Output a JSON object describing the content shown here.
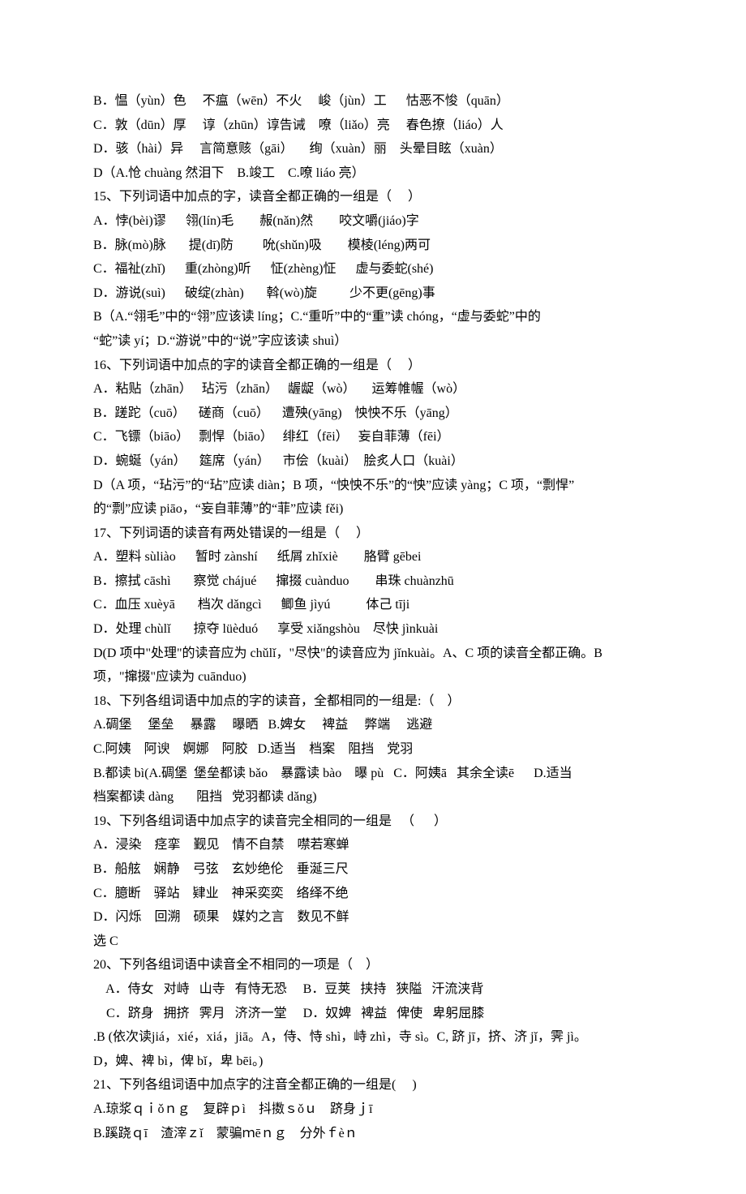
{
  "lines": [
    "B．愠（yùn）色     不瘟（wēn）不火     峻（jùn）工      怙恶不悛（quān）",
    "C．敦（dūn）厚     谆（zhūn）谆告诫    嘹（liǎo）亮     春色撩（liáo）人",
    "D．骇（hài）异     言简意赅（gāi）     绚（xuàn）丽    头晕目眩（xuàn）",
    "D（A.怆 chuàng 然泪下    B.竣工    C.嘹 liáo 亮）",
    "15、下列词语中加点的字，读音全都正确的一组是（     ）",
    "A．悖(bèi)谬      翎(lín)毛        赧(nǎn)然        咬文嚼(jiáo)字",
    "B．脉(mò)脉       提(dī)防         吮(shǔn)吸        模棱(léng)两可",
    "C．福祉(zhǐ)      重(zhòng)听      怔(zhèng)怔      虚与委蛇(shé)",
    "D．游说(suì)      破绽(zhàn)       斡(wò)旋          少不更(gēng)事",
    "B（A.“翎毛”中的“翎”应该读 líng；C.“重听”中的“重”读 chóng，“虚与委蛇”中的",
    "“蛇”读 yí；D.“游说”中的“说”字应该读 shuì）",
    "16、下列词语中加点的字的读音全都正确的一组是（     ）",
    "A．粘贴（zhān）   玷污（zhān）   龌龊（wò）     运筹帷幄（wò）",
    "B．蹉跎（cuō）    磋商（cuō）    遭殃(yāng)    怏怏不乐（yāng）",
    "C．飞镖（biāo）   剽悍（biāo）   绯红（fēi）   妄自菲薄（fēi）",
    "D．蜿蜒（yán）    筵席（yán）    市侩（kuài）  脍炙人口（kuài）",
    "D（A 项，“玷污”的“玷”应读 diàn；B 项，“怏怏不乐”的“怏”应读 yàng；C 项，“剽悍”",
    "的“剽”应读 piāo，“妄自菲薄”的“菲”应读 fěi)",
    "17、下列词语的读音有两处错误的一组是（     ）",
    "A．塑料 sùliào      暂时 zànshí      纸屑 zhǐxiè        胳臂 gēbei",
    "B．擦拭 cāshì       察觉 chájué      撺掇 cuànduo        串珠 chuànzhū",
    "C．血压 xuèyā       档次 dǎngcì      鲫鱼 jìyú           体己 tīji",
    "D．处理 chùlǐ       掠夺 lüèduó      享受 xiǎngshòu    尽快 jìnkuài",
    "D(D 项中\"处理\"的读音应为 chǔlǐ，\"尽快\"的读音应为 jǐnkuài。A、C 项的读音全都正确。B",
    "项，\"撺掇\"应读为 cuānduo)",
    "18、下列各组词语中加点的字的读音，全都相同的一组是:（    ）",
    "A.碉堡     堡垒     暴露     曝晒   B.婢女     裨益     弊端     逃避",
    "C.阿姨    阿谀    婀娜    阿胶   D.适当    档案    阻挡    党羽",
    "B.都读 bì(A.碉堡  堡垒都读 bǎo    暴露读 bào    曝 pù   C．阿姨ā   其余全读ē      D.适当",
    "档案都读 dàng       阻挡   党羽都读 dǎng)",
    "19、下列各组词语中加点字的读音完全相同的一组是   （      ）",
    "A．浸染    痉挛    觐见    情不自禁    噤若寒蝉",
    "B．船舷    娴静    弓弦    玄妙绝伦    垂涎三尺",
    "C．臆断    驿站    肄业    神采奕奕    络绎不绝",
    "D．闪烁    回溯    硕果    媒妁之言    数见不鲜",
    "选 C",
    "20、下列各组词语中读音全不相同的一项是（    ）",
    "    A．侍女   对峙   山寺   有恃无恐     B．豆荚   挟持   狭隘   汗流浃背",
    "    C．跻身   拥挤   霁月   济济一堂     D．奴婢   裨益   俾使   卑躬屈膝",
    ".B (依次读jiá，xié，xiá，jiā。A，侍、恃 shì，峙 zhì，寺 sì。C, 跻 jī，挤、济 jǐ，霁 jì。",
    "D，婢、裨 bì，俾 bǐ，卑 bēi。)",
    "21、下列各组词语中加点字的注音全都正确的一组是(     )",
    "A.琼浆ｑｉǒｎｇ    复辟ｐì    抖擞ｓǒｕ    跻身ｊī",
    "B.蹊跷ｑī    渣滓ｚǐ    蒙骗ｍēｎｇ    分外ｆèｎ"
  ]
}
